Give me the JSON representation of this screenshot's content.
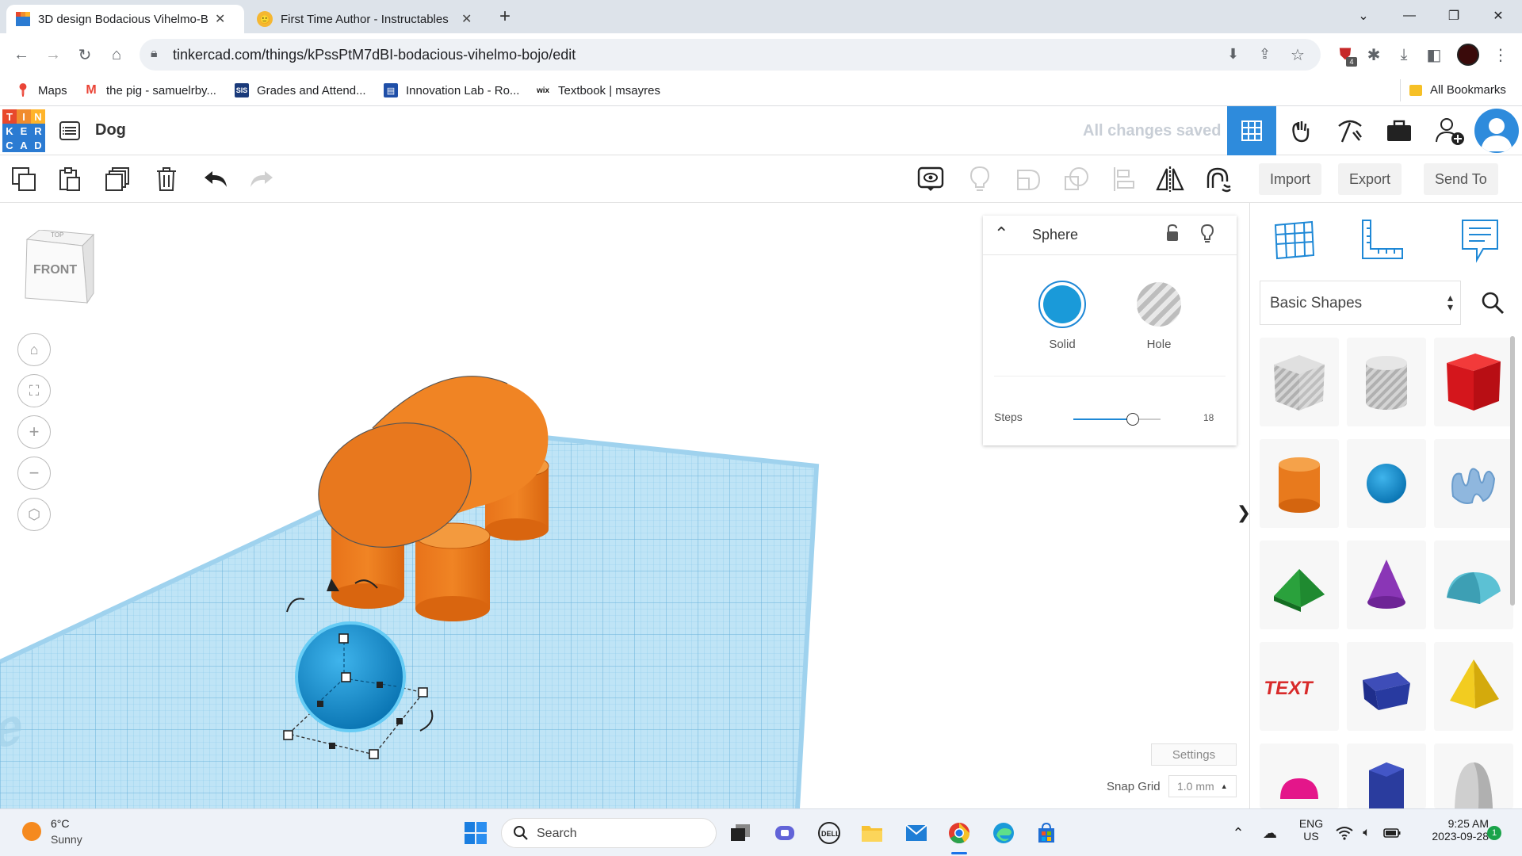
{
  "browser": {
    "tabs": [
      {
        "title": "3D design Bodacious Vihelmo-B",
        "active": true
      },
      {
        "title": "First Time Author - Instructables",
        "active": false
      }
    ],
    "new_tab_label": "+",
    "url": "tinkercad.com/things/kPssPtM7dBI-bodacious-vihelmo-bojo/edit",
    "bookmarks": [
      {
        "label": "Maps",
        "icon": "maps-icon"
      },
      {
        "label": "the pig - samuelrby...",
        "icon": "gmail-icon"
      },
      {
        "label": "Grades and Attend...",
        "icon": "sis-icon"
      },
      {
        "label": "Innovation Lab - Ro...",
        "icon": "docs-icon"
      },
      {
        "label": "Textbook | msayres",
        "icon": "wix-icon"
      }
    ],
    "all_bookmarks_label": "All Bookmarks",
    "sis_badge": "SIS",
    "wix_badge": "wix",
    "ext_badge": "4"
  },
  "app": {
    "logo_letters": [
      "T",
      "I",
      "N",
      "K",
      "E",
      "R",
      "C",
      "A",
      "D"
    ],
    "logo_colors": [
      "#e8482c",
      "#f08c2e",
      "#ffb42a",
      "#2b7bd2",
      "#2b7bd2",
      "#2b7bd2",
      "#2b7bd2",
      "#2b7bd2",
      "#2b7bd2"
    ],
    "design_name": "Dog",
    "save_status": "All changes saved",
    "accent": "#2e8bdc"
  },
  "toolbar": {
    "import_label": "Import",
    "export_label": "Export",
    "send_label": "Send To"
  },
  "viewcube": {
    "front_label": "FRONT",
    "top_label": "TOP"
  },
  "workplane": {
    "label": "Workplane"
  },
  "inspector": {
    "title": "Sphere",
    "solid_label": "Solid",
    "hole_label": "Hole",
    "steps_label": "Steps",
    "steps_value": "18",
    "steps_fraction": 0.68
  },
  "settings": {
    "settings_label": "Settings",
    "snap_label": "Snap Grid",
    "snap_value": "1.0 mm"
  },
  "panel": {
    "category": "Basic Shapes",
    "collapse_glyph": "❯",
    "shapes": [
      "box-hole",
      "cylinder-hole",
      "box",
      "cylinder",
      "sphere",
      "scribble",
      "roof",
      "cone",
      "round-roof",
      "text",
      "wedge",
      "pyramid",
      "half-sphere",
      "polygon",
      "paraboloid"
    ]
  },
  "taskbar": {
    "weather_temp": "6°C",
    "weather_desc": "Sunny",
    "search_label": "Search",
    "lang_top": "ENG",
    "lang_bottom": "US",
    "time": "9:25 AM",
    "date": "2023-09-28",
    "notif_count": "1"
  }
}
